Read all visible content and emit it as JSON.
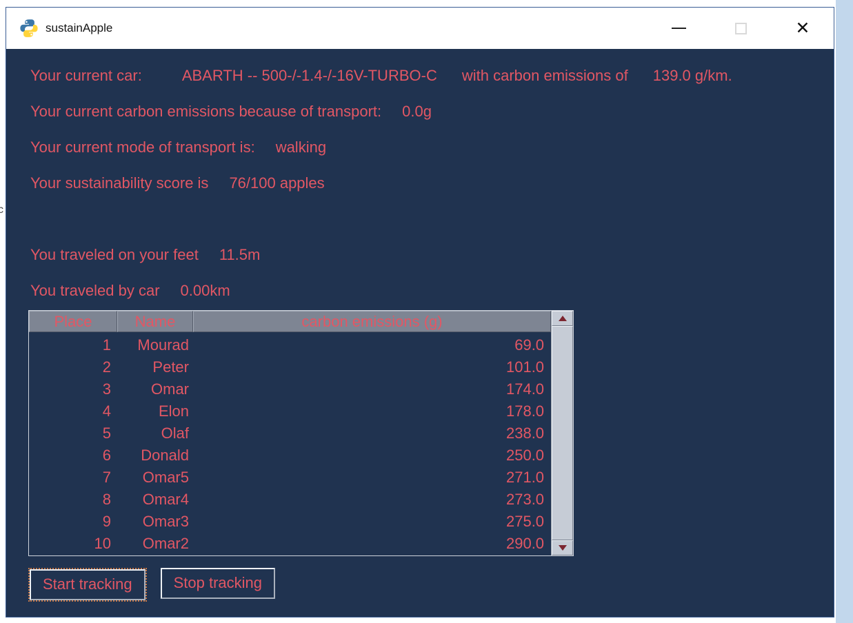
{
  "desktop": {
    "artifact_text": "c"
  },
  "window": {
    "title": "sustainApple"
  },
  "icons": {
    "close": "✕"
  },
  "status": {
    "current_car": {
      "label": "Your current car:",
      "value": "ABARTH -- 500-/-1.4-/-16V-TURBO-C",
      "label2": "with carbon emissions of",
      "value2": "139.0 g/km."
    },
    "transport_emissions": {
      "label": "Your current carbon emissions because of transport:",
      "value": "0.0g"
    },
    "transport_mode": {
      "label": "Your current mode of transport is:",
      "value": "walking"
    },
    "sustainability": {
      "label": "Your sustainability score is",
      "value": "76/100 apples"
    },
    "feet_distance": {
      "label": "You traveled on your feet",
      "value": "11.5m"
    },
    "car_distance": {
      "label": "You traveled by car",
      "value": "0.00km"
    }
  },
  "leaderboard": {
    "headers": [
      "Place",
      "Name",
      "carbon emissions (g)"
    ],
    "rows": [
      {
        "place": "1",
        "name": "Mourad",
        "emissions": "69.0"
      },
      {
        "place": "2",
        "name": "Peter",
        "emissions": "101.0"
      },
      {
        "place": "3",
        "name": "Omar",
        "emissions": "174.0"
      },
      {
        "place": "4",
        "name": "Elon",
        "emissions": "178.0"
      },
      {
        "place": "5",
        "name": "Olaf",
        "emissions": "238.0"
      },
      {
        "place": "6",
        "name": "Donald",
        "emissions": "250.0"
      },
      {
        "place": "7",
        "name": "Omar5",
        "emissions": "271.0"
      },
      {
        "place": "8",
        "name": "Omar4",
        "emissions": "273.0"
      },
      {
        "place": "9",
        "name": "Omar3",
        "emissions": "275.0"
      },
      {
        "place": "10",
        "name": "Omar2",
        "emissions": "290.0"
      }
    ]
  },
  "buttons": {
    "start": "Start tracking",
    "stop": "Stop tracking"
  },
  "colors": {
    "window_bg": "#203350",
    "accent_text": "#e25764",
    "header_bg": "#7e8593",
    "titlebar_bg": "#ffffff",
    "scrollbar_arrow": "#7c2630",
    "focus_ring": "#c77848"
  }
}
